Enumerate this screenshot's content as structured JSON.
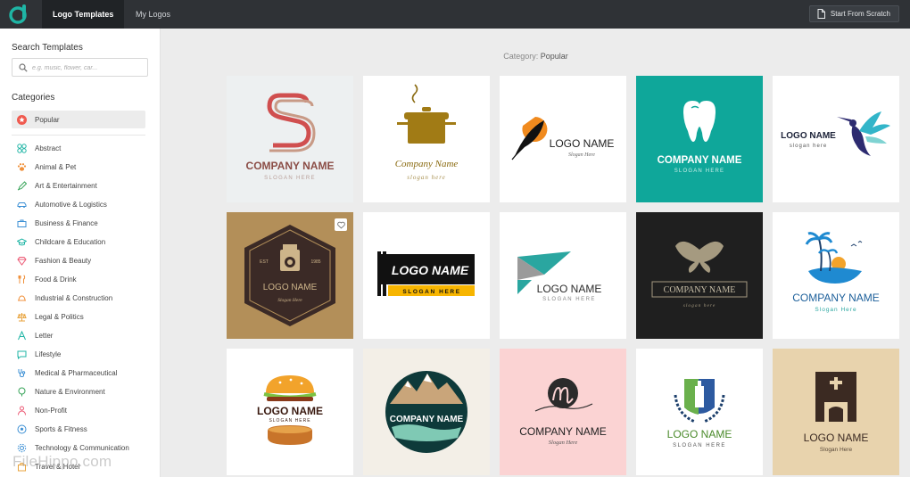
{
  "topbar": {
    "tabs": [
      {
        "label": "Logo Templates",
        "active": true
      },
      {
        "label": "My Logos",
        "active": false
      }
    ],
    "start_button": "Start From Scratch",
    "brand_color": "#1fb5a5"
  },
  "sidebar": {
    "search_heading": "Search Templates",
    "search_placeholder": "e.g. music, flower, car...",
    "categories_heading": "Categories",
    "categories": [
      {
        "label": "Popular",
        "icon": "star-badge-icon",
        "active": true
      },
      {
        "label": "Abstract",
        "icon": "abstract-icon"
      },
      {
        "label": "Animal & Pet",
        "icon": "paw-icon"
      },
      {
        "label": "Art & Entertainment",
        "icon": "palette-icon"
      },
      {
        "label": "Automotive & Logistics",
        "icon": "car-icon"
      },
      {
        "label": "Business & Finance",
        "icon": "briefcase-icon"
      },
      {
        "label": "Childcare & Education",
        "icon": "graduation-cap-icon"
      },
      {
        "label": "Fashion & Beauty",
        "icon": "diamond-icon"
      },
      {
        "label": "Food & Drink",
        "icon": "cutlery-icon"
      },
      {
        "label": "Industrial & Construction",
        "icon": "hard-hat-icon"
      },
      {
        "label": "Legal & Politics",
        "icon": "scales-icon"
      },
      {
        "label": "Letter",
        "icon": "letter-a-icon"
      },
      {
        "label": "Lifestyle",
        "icon": "chat-bubble-icon"
      },
      {
        "label": "Medical & Pharmaceutical",
        "icon": "stethoscope-icon"
      },
      {
        "label": "Nature & Environment",
        "icon": "tree-icon"
      },
      {
        "label": "Non-Profit",
        "icon": "hands-icon"
      },
      {
        "label": "Sports & Fitness",
        "icon": "soccer-ball-icon"
      },
      {
        "label": "Technology & Communication",
        "icon": "gear-icon"
      },
      {
        "label": "Travel & Hotel",
        "icon": "suitcase-icon"
      }
    ]
  },
  "main": {
    "category_prefix": "Category:",
    "category_value": "Popular",
    "templates": [
      {
        "name": "COMPANY NAME",
        "slogan": "SLOGAN HERE",
        "bg": "#edf0f1"
      },
      {
        "name": "Company Name",
        "slogan": "slogan here",
        "bg": "#ffffff"
      },
      {
        "name": "LOGO NAME",
        "slogan": "Slogan Here",
        "bg": "#ffffff"
      },
      {
        "name": "COMPANY NAME",
        "slogan": "SLOGAN HERE",
        "bg": "#0fa79a"
      },
      {
        "name": "LOGO NAME",
        "slogan": "slogan here",
        "bg": "#ffffff"
      },
      {
        "name": "LOGO NAME",
        "slogan": "Slogan Here",
        "bg": "#b38f59",
        "year_left": "EST",
        "year_right": "1985"
      },
      {
        "name": "LOGO NAME",
        "slogan": "SLOGAN HERE",
        "bg": "#ffffff"
      },
      {
        "name": "LOGO NAME",
        "slogan": "SLOGAN HERE",
        "bg": "#ffffff"
      },
      {
        "name": "COMPANY NAME",
        "slogan": "slogan here",
        "bg": "#1f1f1f"
      },
      {
        "name": "COMPANY NAME",
        "slogan": "Slogan Here",
        "bg": "#ffffff"
      },
      {
        "name": "LOGO NAME",
        "slogan": "SLOGAN HERE",
        "bg": "#ffffff"
      },
      {
        "name": "COMPANY NAME",
        "slogan": "",
        "bg": "#f3efe7"
      },
      {
        "name": "COMPANY NAME",
        "slogan": "Slogan Here",
        "bg": "#fbd3d3"
      },
      {
        "name": "LOGO NAME",
        "slogan": "SLOGAN HERE",
        "bg": "#ffffff"
      },
      {
        "name": "LOGO NAME",
        "slogan": "Slogan Here",
        "bg": "#e8d3ad"
      }
    ]
  },
  "watermark": "FileHippo.com"
}
